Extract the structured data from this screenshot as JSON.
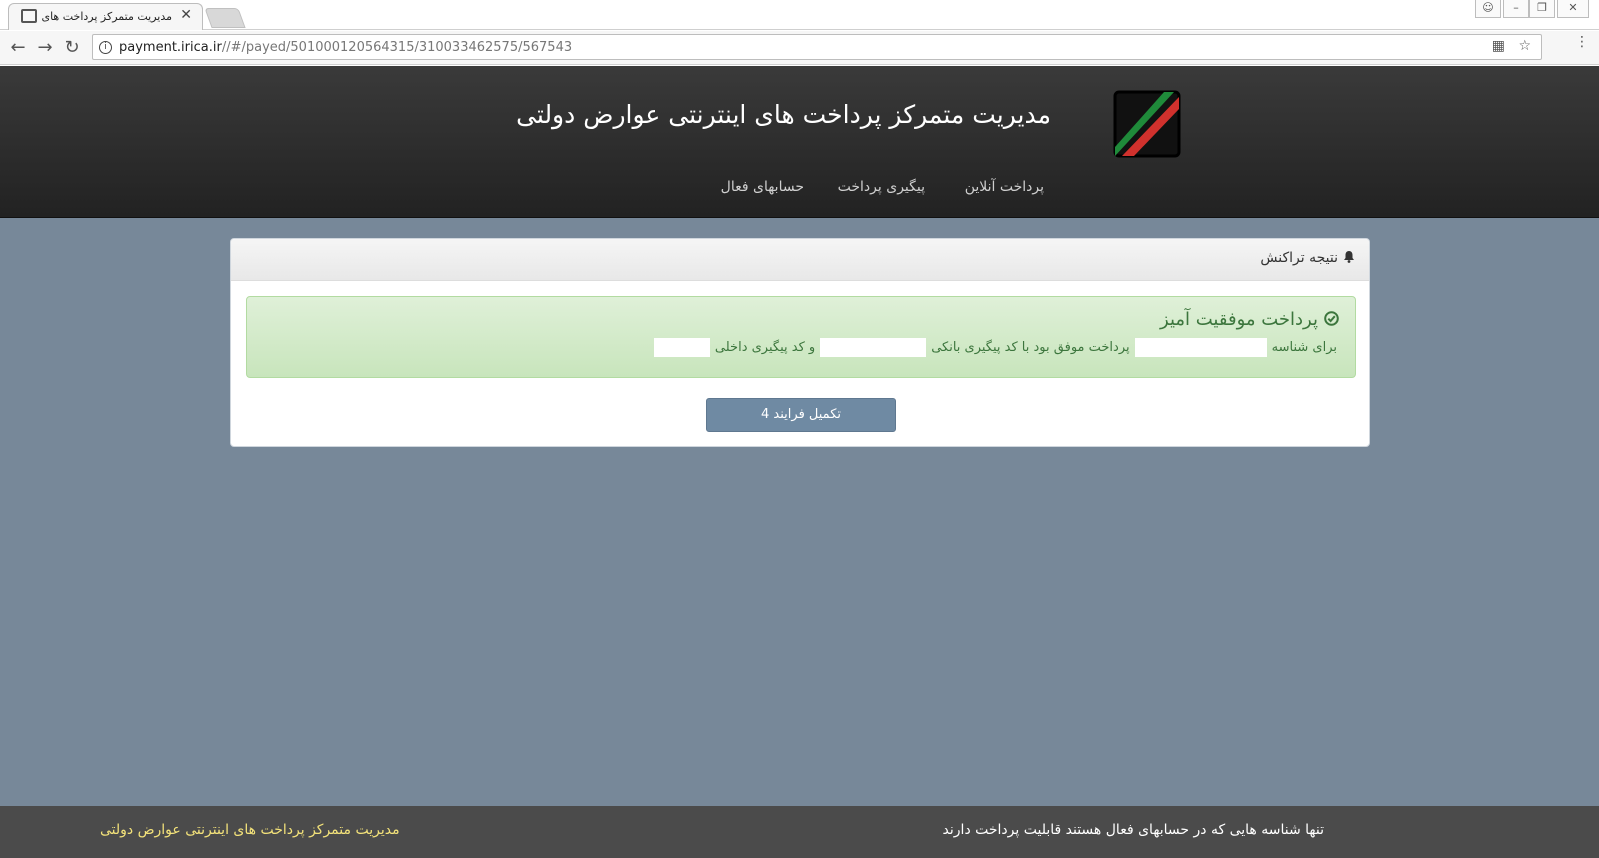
{
  "browser": {
    "tab_title": "مدیریت متمرکز پرداخت های",
    "tab_close": "✕",
    "url_host": "payment.irica.ir",
    "url_path": "//#/payed/501000120564315/310033462575/567543"
  },
  "header": {
    "title": "مدیریت متمرکز پرداخت های اینترنتی عوارض دولتی",
    "nav": [
      "پرداخت آنلاین",
      "پیگیری پرداخت",
      "حسابهای فعال"
    ]
  },
  "panel": {
    "heading": "نتیجه تراکنش",
    "alert_title": "پرداخت موفقیت آمیز",
    "line_part1": "برای شناسه",
    "line_part2": "پرداخت موفق بود با کد پیگیری بانکی",
    "line_part3": "و کد پیگیری داخلی",
    "button": "تکمیل فرایند 4"
  },
  "footer": {
    "left": "مدیریت متمرکز پرداخت های اینترنتی عوارض دولتی",
    "right": "تنها شناسه هایی که در حسابهای فعال هستند قابلیت پرداخت دارند"
  },
  "colors": {
    "page_bg": "#778899",
    "header_bg": "#2b2b2b",
    "success_text": "#3c763d",
    "button": "#6f8aa3",
    "footer_bg": "#4b4b4b",
    "footer_accent": "#f3e27a"
  }
}
